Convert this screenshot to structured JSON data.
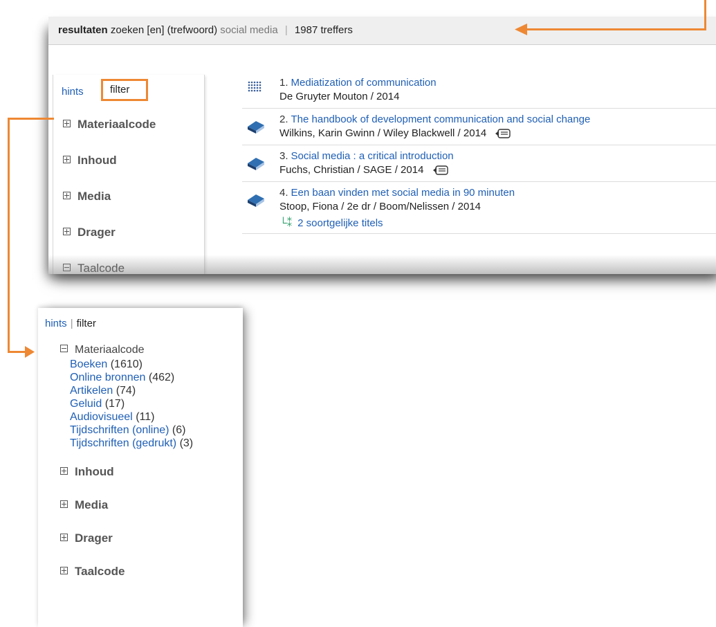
{
  "result_bar": {
    "label": "resultaten",
    "query_prefix": "zoeken [en] (trefwoord)",
    "query_term": "social media",
    "separator": "|",
    "count": "1987 treffers"
  },
  "tabs": {
    "hints": "hints",
    "separator": "|",
    "filter": "filter"
  },
  "top_facets": [
    {
      "label": "Materiaalcode",
      "state": "collapsed"
    },
    {
      "label": "Inhoud",
      "state": "collapsed"
    },
    {
      "label": "Media",
      "state": "collapsed"
    },
    {
      "label": "Drager",
      "state": "collapsed"
    },
    {
      "label": "Taalcode",
      "state": "expanded"
    }
  ],
  "results": [
    {
      "num": "1.",
      "title": "Mediatization of communication",
      "meta": "De Gruyter Mouton / 2014",
      "icon": "dots-grid-icon",
      "ebook": false
    },
    {
      "num": "2.",
      "title": "The handbook of development communication and social change",
      "meta": "Wilkins, Karin Gwinn / Wiley Blackwell / 2014",
      "icon": "book-icon",
      "ebook": true
    },
    {
      "num": "3.",
      "title": "Social media : a critical introduction",
      "meta": "Fuchs, Christian / SAGE / 2014",
      "icon": "book-icon",
      "ebook": true
    },
    {
      "num": "4.",
      "title": "Een baan vinden met social media in 90 minuten",
      "meta": "Stoop, Fiona / 2e dr / Boom/Nelissen / 2014",
      "icon": "book-icon",
      "ebook": false,
      "similar": "2  soortgelijke titels"
    }
  ],
  "bottom_sidebar": {
    "materiaal": {
      "label": "Materiaalcode",
      "items": [
        {
          "label": "Boeken",
          "count": "(1610)"
        },
        {
          "label": "Online bronnen",
          "count": "(462)"
        },
        {
          "label": "Artikelen",
          "count": "(74)"
        },
        {
          "label": "Geluid",
          "count": "(17)"
        },
        {
          "label": "Audiovisueel",
          "count": "(11)"
        },
        {
          "label": "Tijdschriften (online)",
          "count": "(6)"
        },
        {
          "label": "Tijdschriften (gedrukt)",
          "count": "(3)"
        }
      ]
    },
    "facets": [
      {
        "label": "Inhoud"
      },
      {
        "label": "Media"
      },
      {
        "label": "Drager"
      },
      {
        "label": "Taalcode"
      }
    ]
  },
  "colors": {
    "accent": "#ee8833",
    "link": "#1f5fb5"
  }
}
